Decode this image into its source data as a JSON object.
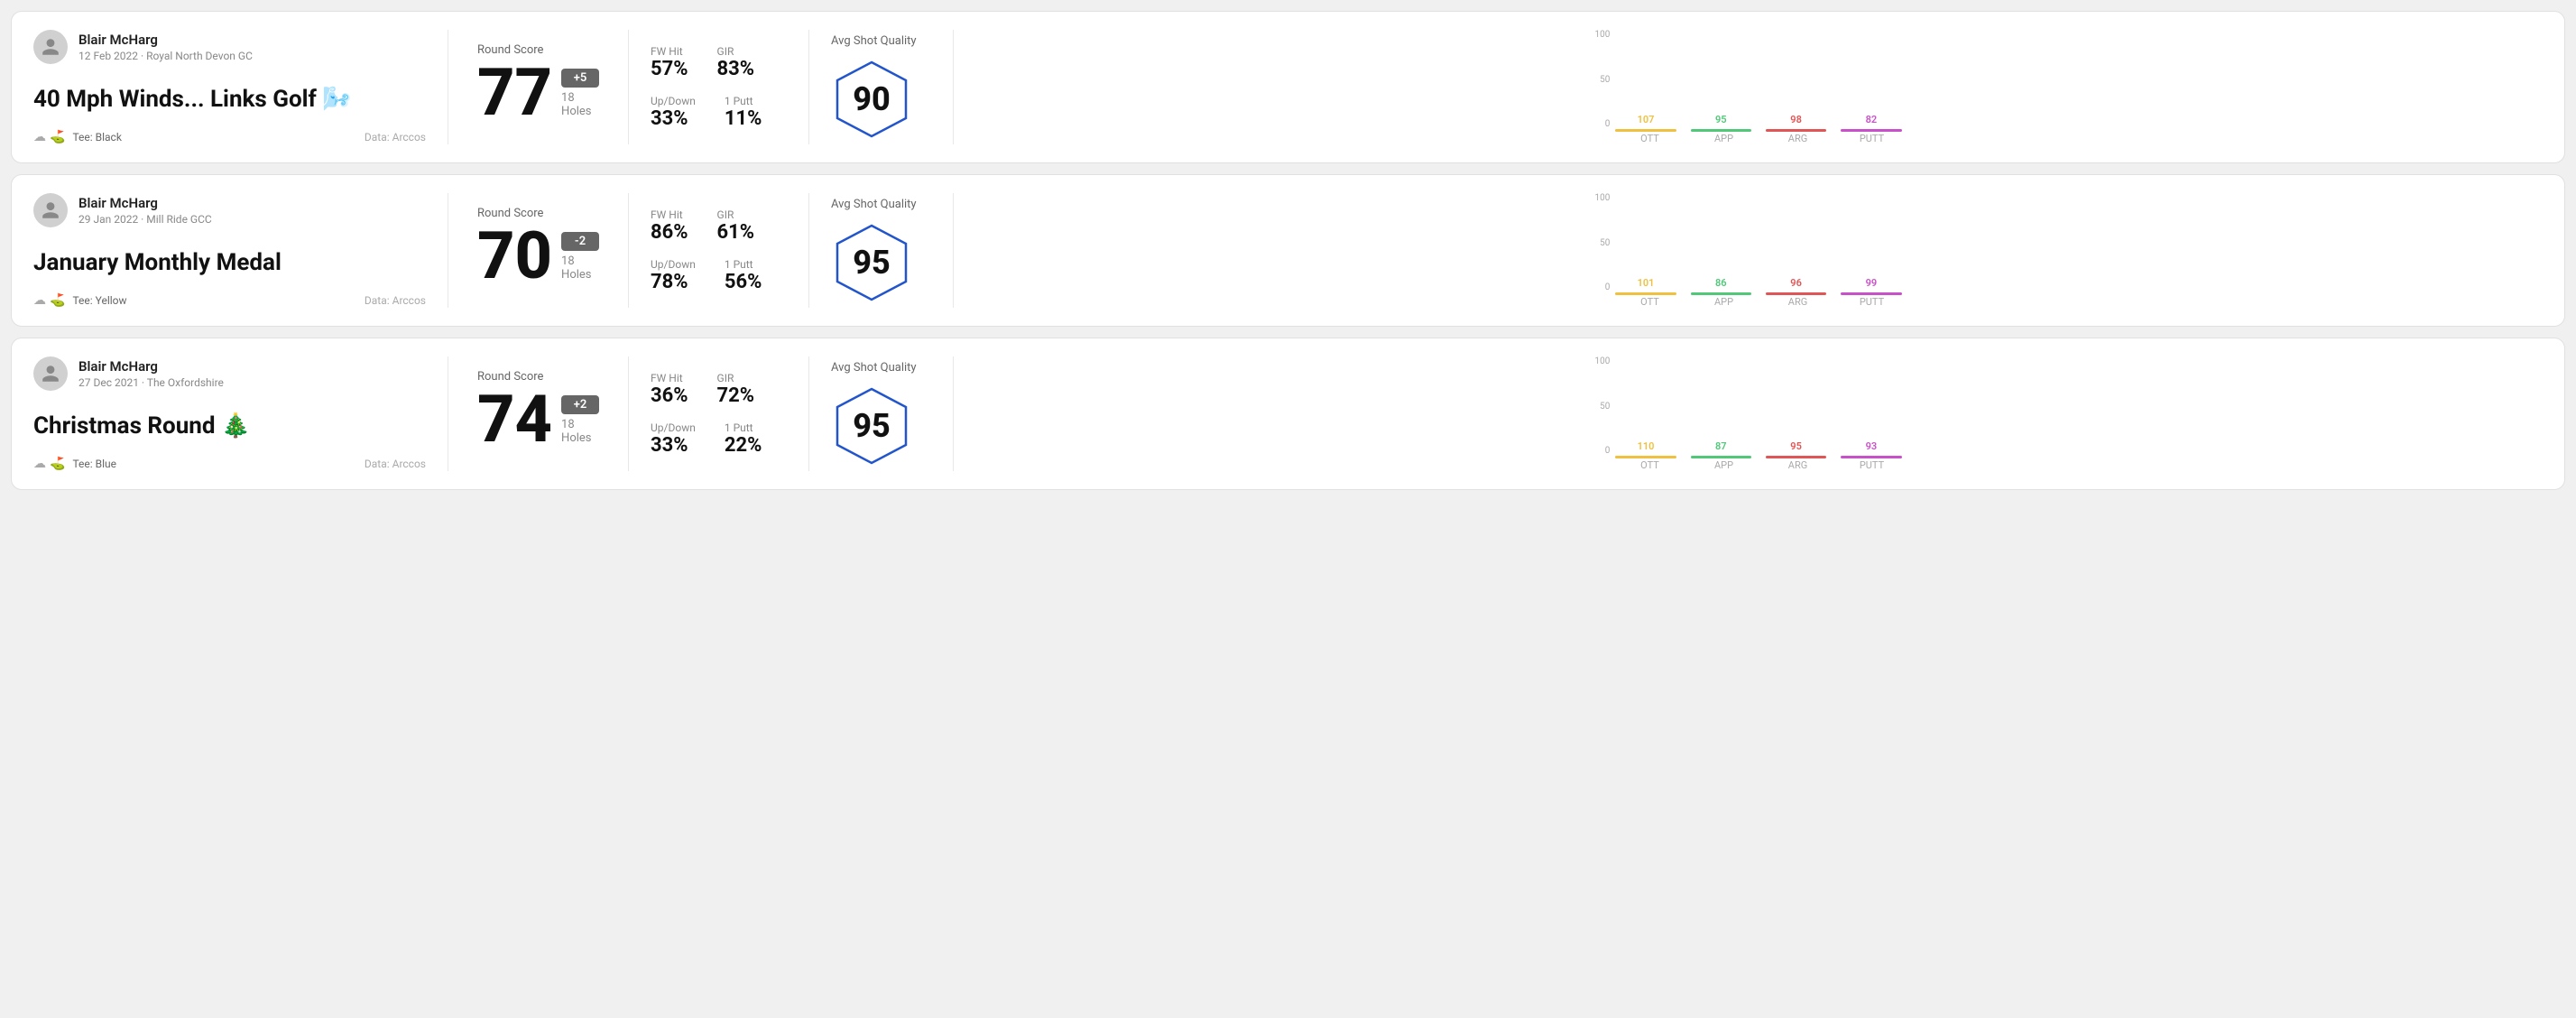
{
  "rounds": [
    {
      "id": "round-1",
      "user": {
        "name": "Blair McHarg",
        "date_course": "12 Feb 2022 · Royal North Devon GC"
      },
      "title": "40 Mph Winds... Links Golf",
      "title_emoji": "🌬️",
      "tee": "Black",
      "data_source": "Data: Arccos",
      "score": {
        "label": "Round Score",
        "value": "77",
        "badge": "+5",
        "badge_type": "positive",
        "holes": "18 Holes"
      },
      "stats": {
        "fw_hit_label": "FW Hit",
        "fw_hit_value": "57%",
        "gir_label": "GIR",
        "gir_value": "83%",
        "updown_label": "Up/Down",
        "updown_value": "33%",
        "putt_label": "1 Putt",
        "putt_value": "11%"
      },
      "quality": {
        "label": "Avg Shot Quality",
        "value": "90"
      },
      "chart": {
        "bars": [
          {
            "label": "OTT",
            "top_value": "107",
            "color": "#f0c040",
            "fill_pct": 80
          },
          {
            "label": "APP",
            "top_value": "95",
            "color": "#50c878",
            "fill_pct": 72
          },
          {
            "label": "ARG",
            "top_value": "98",
            "color": "#e05555",
            "fill_pct": 75
          },
          {
            "label": "PUTT",
            "top_value": "82",
            "color": "#c850c8",
            "fill_pct": 62
          }
        ],
        "y_labels": [
          "100",
          "50",
          "0"
        ]
      }
    },
    {
      "id": "round-2",
      "user": {
        "name": "Blair McHarg",
        "date_course": "29 Jan 2022 · Mill Ride GCC"
      },
      "title": "January Monthly Medal",
      "title_emoji": "",
      "tee": "Yellow",
      "data_source": "Data: Arccos",
      "score": {
        "label": "Round Score",
        "value": "70",
        "badge": "-2",
        "badge_type": "negative",
        "holes": "18 Holes"
      },
      "stats": {
        "fw_hit_label": "FW Hit",
        "fw_hit_value": "86%",
        "gir_label": "GIR",
        "gir_value": "61%",
        "updown_label": "Up/Down",
        "updown_value": "78%",
        "putt_label": "1 Putt",
        "putt_value": "56%"
      },
      "quality": {
        "label": "Avg Shot Quality",
        "value": "95"
      },
      "chart": {
        "bars": [
          {
            "label": "OTT",
            "top_value": "101",
            "color": "#f0c040",
            "fill_pct": 78
          },
          {
            "label": "APP",
            "top_value": "86",
            "color": "#50c878",
            "fill_pct": 66
          },
          {
            "label": "ARG",
            "top_value": "96",
            "color": "#e05555",
            "fill_pct": 74
          },
          {
            "label": "PUTT",
            "top_value": "99",
            "color": "#c850c8",
            "fill_pct": 76
          }
        ],
        "y_labels": [
          "100",
          "50",
          "0"
        ]
      }
    },
    {
      "id": "round-3",
      "user": {
        "name": "Blair McHarg",
        "date_course": "27 Dec 2021 · The Oxfordshire"
      },
      "title": "Christmas Round",
      "title_emoji": "🎄",
      "tee": "Blue",
      "data_source": "Data: Arccos",
      "score": {
        "label": "Round Score",
        "value": "74",
        "badge": "+2",
        "badge_type": "positive",
        "holes": "18 Holes"
      },
      "stats": {
        "fw_hit_label": "FW Hit",
        "fw_hit_value": "36%",
        "gir_label": "GIR",
        "gir_value": "72%",
        "updown_label": "Up/Down",
        "updown_value": "33%",
        "putt_label": "1 Putt",
        "putt_value": "22%"
      },
      "quality": {
        "label": "Avg Shot Quality",
        "value": "95"
      },
      "chart": {
        "bars": [
          {
            "label": "OTT",
            "top_value": "110",
            "color": "#f0c040",
            "fill_pct": 85
          },
          {
            "label": "APP",
            "top_value": "87",
            "color": "#50c878",
            "fill_pct": 67
          },
          {
            "label": "ARG",
            "top_value": "95",
            "color": "#e05555",
            "fill_pct": 73
          },
          {
            "label": "PUTT",
            "top_value": "93",
            "color": "#c850c8",
            "fill_pct": 71
          }
        ],
        "y_labels": [
          "100",
          "50",
          "0"
        ]
      }
    }
  ]
}
